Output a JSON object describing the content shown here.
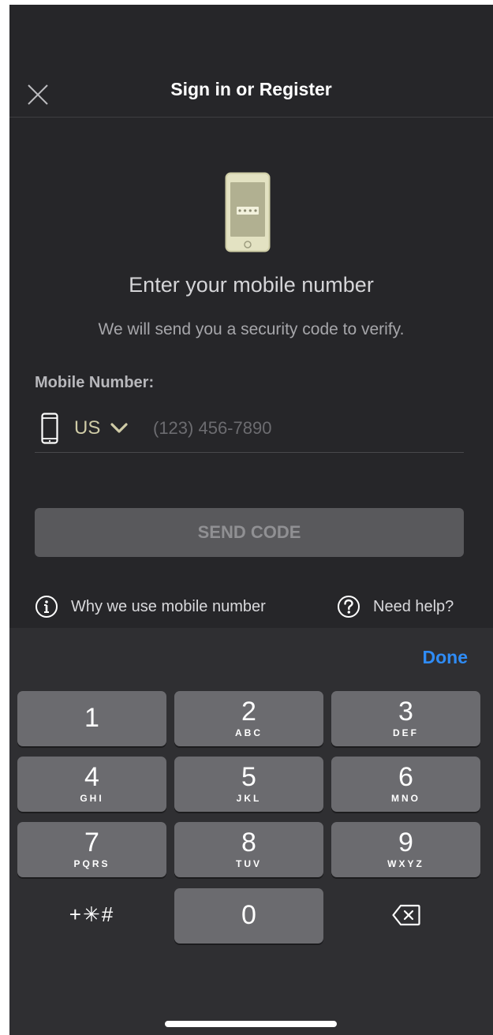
{
  "nav": {
    "title": "Sign in or Register",
    "close_icon": "close-icon"
  },
  "main": {
    "illustration_icon": "phone-code-icon",
    "heading": "Enter your mobile number",
    "subheading": "We will send you a security code to verify.",
    "field_label": "Mobile Number:",
    "country_code": "US",
    "phone_value": "",
    "phone_placeholder": "(123) 456-7890",
    "send_button": "SEND CODE",
    "links": {
      "why": "Why we use mobile number",
      "help": "Need help?"
    }
  },
  "keyboard": {
    "done_label": "Done",
    "keys": [
      {
        "digit": "1",
        "letters": ""
      },
      {
        "digit": "2",
        "letters": "ABC"
      },
      {
        "digit": "3",
        "letters": "DEF"
      },
      {
        "digit": "4",
        "letters": "GHI"
      },
      {
        "digit": "5",
        "letters": "JKL"
      },
      {
        "digit": "6",
        "letters": "MNO"
      },
      {
        "digit": "7",
        "letters": "PQRS"
      },
      {
        "digit": "8",
        "letters": "TUV"
      },
      {
        "digit": "9",
        "letters": "WXYZ"
      }
    ],
    "symbols": "+✳#",
    "zero": "0",
    "backspace_icon": "backspace-icon"
  },
  "colors": {
    "background": "#262629",
    "accent_blue": "#2f8cf6",
    "country_gold": "#cfcba6",
    "illustration_fill": "#e3e2c2"
  }
}
